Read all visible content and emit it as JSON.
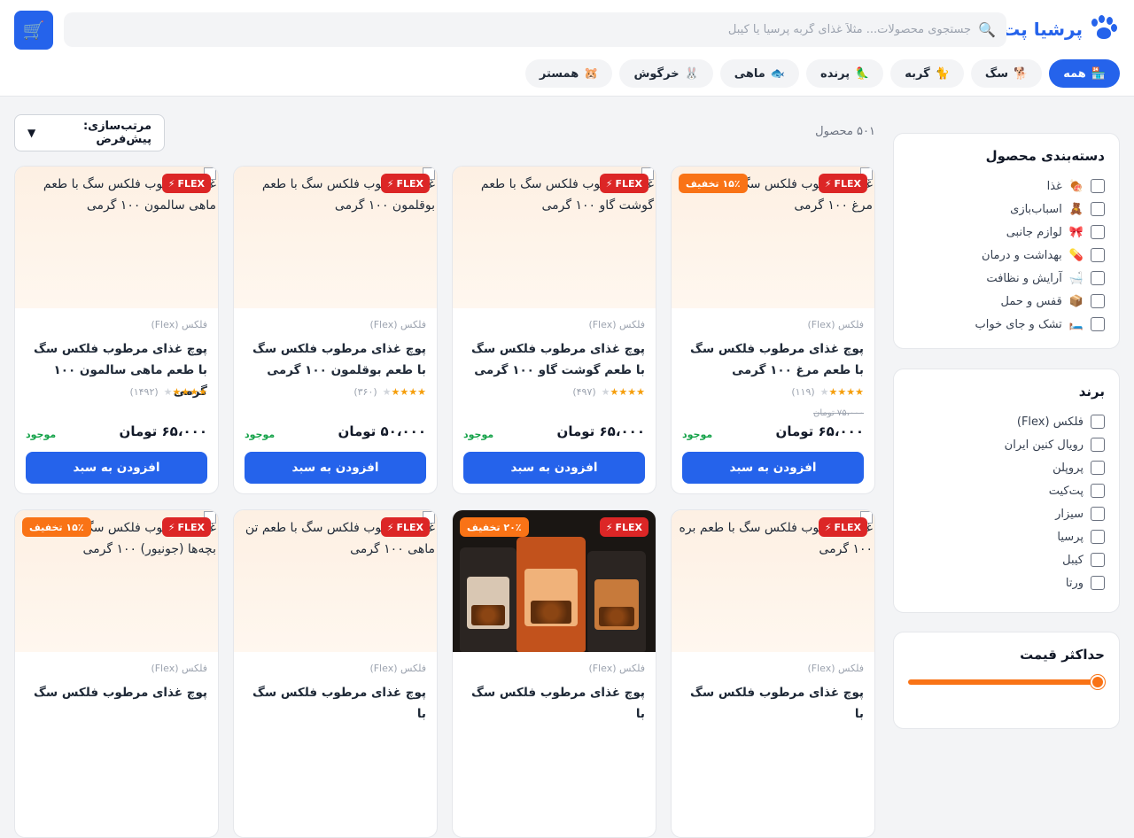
{
  "header": {
    "logo_text": "پرشیا پت",
    "search_placeholder": "جستجوی محصولات... مثلاً غذای گربه پرسیا یا کیبل",
    "cart_icon": "cart-icon"
  },
  "categories": [
    {
      "label": "همه",
      "emoji": "🏪"
    },
    {
      "label": "سگ",
      "emoji": "🐕"
    },
    {
      "label": "گربه",
      "emoji": "🐈"
    },
    {
      "label": "پرنده",
      "emoji": "🦜"
    },
    {
      "label": "ماهی",
      "emoji": "🐟"
    },
    {
      "label": "خرگوش",
      "emoji": "🐰"
    },
    {
      "label": "همستر",
      "emoji": "🐹"
    }
  ],
  "sidebar": {
    "category_title": "دسته‌بندی محصول",
    "category_items": [
      {
        "emoji": "🍖",
        "label": "غذا"
      },
      {
        "emoji": "🧸",
        "label": "اسباب‌بازی"
      },
      {
        "emoji": "🎀",
        "label": "لوازم جانبی"
      },
      {
        "emoji": "💊",
        "label": "بهداشت و درمان"
      },
      {
        "emoji": "🛁",
        "label": "آرایش و نظافت"
      },
      {
        "emoji": "📦",
        "label": "قفس و حمل"
      },
      {
        "emoji": "🛏️",
        "label": "تشک و جای خواب"
      }
    ],
    "brand_title": "برند",
    "brand_items": [
      "فلکس (Flex)",
      "رویال کنین ایران",
      "پروپلن",
      "پت‌کیت",
      "سیزار",
      "پرسیا",
      "کیبل",
      "ورتا"
    ],
    "price_title": "حداکثر قیمت",
    "price_fraction": 1.0
  },
  "toolbar": {
    "count": "۵۰۱ محصول",
    "sort_label": "مرتب‌سازی: پیش‌فرض"
  },
  "ui": {
    "flex_label": "FLEX",
    "flex_symbol": "⚡",
    "add_label": "افزودن به سبد",
    "stock_label": "موجود",
    "star_chars": "★★★★",
    "star_off": "★"
  },
  "products": [
    {
      "alt": "غذای مرطوب فلکس سگ با طعم مرغ ۱۰۰ گرمی",
      "brand": "فلکس (Flex)",
      "title": "پوچ غذای مرطوب فلکس سگ با طعم مرغ ۱۰۰ گرمی",
      "reviews": "(۱۱۹)",
      "old_price": "۷۵،۰۰۰ تومان",
      "price": "۶۵،۰۰۰ تومان",
      "discount": "۱۵٪ تخفیف",
      "photo": false
    },
    {
      "alt": "غذای مرطوب فلکس سگ با طعم گوشت گاو ۱۰۰ گرمی",
      "brand": "فلکس (Flex)",
      "title": "پوچ غذای مرطوب فلکس سگ با طعم گوشت گاو ۱۰۰ گرمی",
      "reviews": "(۴۹۷)",
      "old_price": "",
      "price": "۶۵،۰۰۰ تومان",
      "discount": "",
      "photo": false
    },
    {
      "alt": "غذای مرطوب فلکس سگ با طعم بوقلمون ۱۰۰ گرمی",
      "brand": "فلکس (Flex)",
      "title": "پوچ غذای مرطوب فلکس سگ با طعم بوقلمون ۱۰۰ گرمی",
      "reviews": "(۳۶۰)",
      "old_price": "",
      "price": "۵۰،۰۰۰ تومان",
      "discount": "",
      "photo": false
    },
    {
      "alt": "غذای مرطوب فلکس سگ با طعم ماهی سالمون ۱۰۰ گرمی",
      "brand": "فلکس (Flex)",
      "title": "پوچ غذای مرطوب فلکس سگ با طعم ماهی سالمون ۱۰۰ گرمی",
      "reviews": "(۱۴۹۲)",
      "old_price": "",
      "price": "۶۵،۰۰۰ تومان",
      "discount": "",
      "photo": false
    },
    {
      "alt": "غذای مرطوب فلکس سگ با طعم بره ۱۰۰ گرمی",
      "brand": "فلکس (Flex)",
      "title": "پوچ غذای مرطوب فلکس سگ با",
      "reviews": "",
      "old_price": "",
      "price": "",
      "discount": "",
      "photo": false
    },
    {
      "alt": "",
      "brand": "فلکس (Flex)",
      "title": "پوچ غذای مرطوب فلکس سگ با",
      "reviews": "",
      "old_price": "",
      "price": "",
      "discount": "۲۰٪ تخفیف",
      "photo": true
    },
    {
      "alt": "غذای مرطوب فلکس سگ با طعم تن ماهی ۱۰۰ گرمی",
      "brand": "فلکس (Flex)",
      "title": "پوچ غذای مرطوب فلکس سگ با",
      "reviews": "",
      "old_price": "",
      "price": "",
      "discount": "",
      "photo": false
    },
    {
      "alt": "غذای مرطوب فلکس سگ مخصوص بچه‌ها (جونیور) ۱۰۰ گرمی",
      "brand": "فلکس (Flex)",
      "title": "پوچ غذای مرطوب فلکس سگ",
      "reviews": "",
      "old_price": "",
      "price": "",
      "discount": "۱۵٪ تخفیف",
      "photo": false
    }
  ]
}
